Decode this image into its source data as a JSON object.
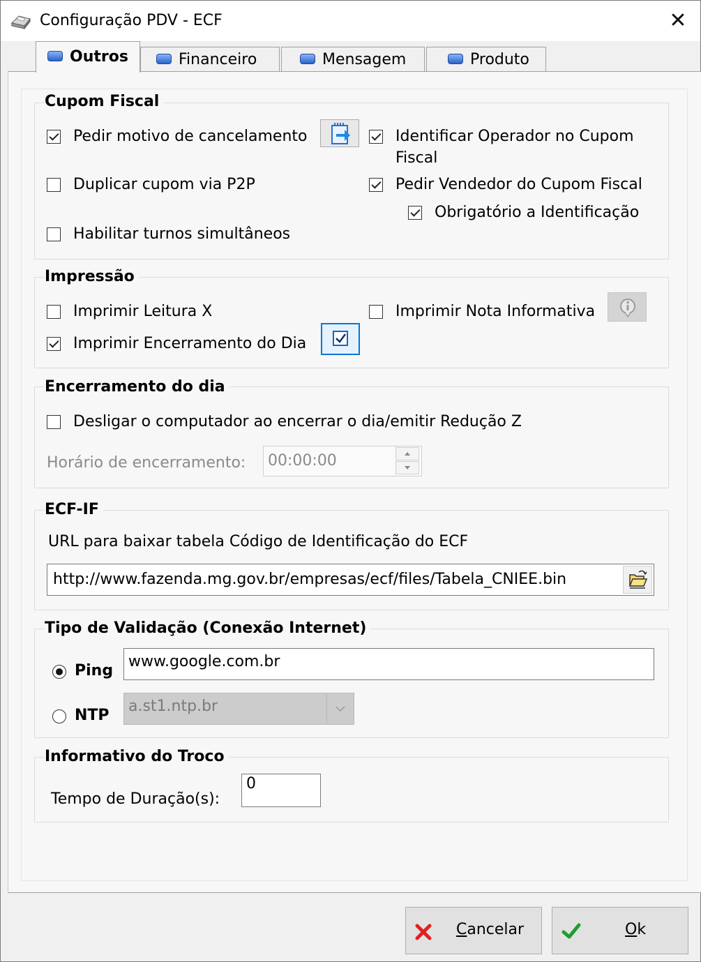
{
  "window": {
    "title": "Configuração PDV - ECF",
    "close_glyph": "✕"
  },
  "tabs": [
    {
      "label": "Outros",
      "active": true
    },
    {
      "label": "Financeiro",
      "active": false
    },
    {
      "label": "Mensagem",
      "active": false
    },
    {
      "label": "Produto",
      "active": false
    }
  ],
  "cupom_fiscal": {
    "title": "Cupom Fiscal",
    "pedir_motivo": {
      "label": "Pedir motivo de cancelamento",
      "checked": true
    },
    "identificar_operador": {
      "label_line1": "Identificar Operador no Cupom",
      "label_line2": "Fiscal",
      "checked": true
    },
    "duplicar_cupom": {
      "label": "Duplicar cupom via P2P",
      "checked": false
    },
    "pedir_vendedor": {
      "label": "Pedir Vendedor do Cupom Fiscal",
      "checked": true
    },
    "obrigatorio": {
      "label": "Obrigatório a Identificação",
      "checked": true
    },
    "turnos": {
      "label": "Habilitar turnos simultâneos",
      "checked": false
    }
  },
  "impressao": {
    "title": "Impressão",
    "leitura_x": {
      "label": "Imprimir Leitura X",
      "checked": false
    },
    "nota_informativa": {
      "label": "Imprimir Nota Informativa",
      "checked": false
    },
    "encerramento": {
      "label": "Imprimir Encerramento do Dia",
      "checked": true
    }
  },
  "encerramento_dia": {
    "title": "Encerramento do dia",
    "desligar": {
      "label": "Desligar o computador ao encerrar o dia/emitir Redução Z",
      "checked": false
    },
    "horario_label": "Horário de encerramento:",
    "horario_value": "00:00:00"
  },
  "ecf_if": {
    "title": "ECF-IF",
    "url_label": "URL para baixar tabela Código de Identificação do ECF",
    "url_value": "http://www.fazenda.mg.gov.br/empresas/ecf/files/Tabela_CNIEE.bin"
  },
  "validacao": {
    "title": "Tipo de Validação (Conexão Internet)",
    "ping": {
      "label": "Ping",
      "selected": true,
      "value": "www.google.com.br"
    },
    "ntp": {
      "label": "NTP",
      "selected": false,
      "value": "a.st1.ntp.br"
    }
  },
  "troco": {
    "title": "Informativo do Troco",
    "duracao_label": "Tempo de Duração(s):",
    "duracao_value": "0"
  },
  "footer": {
    "cancel": {
      "label": "Cancelar",
      "mnemonic": "C",
      "rest": "ancelar"
    },
    "ok": {
      "label": "Ok",
      "mnemonic": "O",
      "rest": "k"
    }
  },
  "colors": {
    "accent_tab": "#2a63c7",
    "cancel_icon": "#e02020",
    "ok_icon": "#1f9e2f",
    "focus_border": "#0078d7"
  }
}
